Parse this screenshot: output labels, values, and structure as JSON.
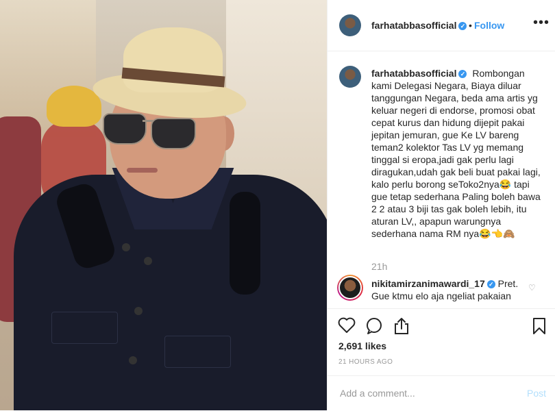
{
  "post": {
    "username": "farhatabbasofficial",
    "verified_mark": "✓",
    "follow_sep": "•",
    "follow_label": "Follow",
    "more_label": "•••"
  },
  "caption": {
    "username": "farhatabbasofficial",
    "text": "Rombongan kami Delegasi Negara, Biaya diluar tanggungan Negara, beda ama artis yg keluar negeri di endorse, promosi obat cepat kurus dan hidung dijepit pakai jepitan jemuran, gue Ke LV bareng teman2 kolektor Tas LV yg memang tinggal si eropa,jadi gak perlu lagi diragukan,udah gak beli buat pakai lagi, kalo perlu borong seToko2nya😂 tapi gue tetap sederhana Paling boleh bawa 2 2 atau 3 biji tas gak boleh lebih, itu aturan LV,, apapun warungnya sederhana nama RM nya😂👈🙈",
    "time": "21h"
  },
  "comment": {
    "username": "nikitamirzanimawardi_17",
    "text": "Pret. Gue ktmu elo aja ngeliat pakaian"
  },
  "actions": {
    "like_icon": "heart-icon",
    "comment_icon": "comment-icon",
    "share_icon": "share-icon",
    "save_icon": "bookmark-icon",
    "likes": "2,691 likes",
    "ago": "21 HOURS AGO"
  },
  "add_comment": {
    "placeholder": "Add a comment...",
    "post_label": "Post"
  },
  "colors": {
    "accent": "#3897f0",
    "muted": "#999999",
    "post_disabled": "#b2dffc"
  }
}
